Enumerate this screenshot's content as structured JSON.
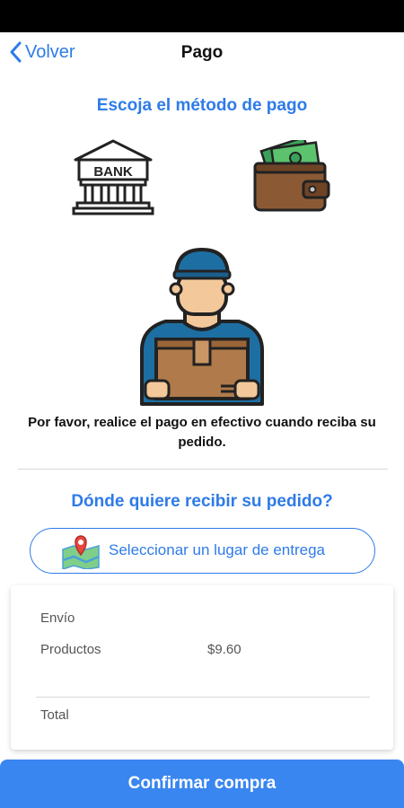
{
  "header": {
    "back_label": "Volver",
    "title": "Pago"
  },
  "payment": {
    "heading": "Escoja el método de pago",
    "bank_text": "BANK",
    "cash_message": "Por favor, realice el pago en efectivo cuando reciba su pedido."
  },
  "delivery": {
    "heading": "Dónde quiere recibir su pedido?",
    "select_label": "Seleccionar un lugar de entrega"
  },
  "summary": {
    "shipping_label": "Envío",
    "shipping_value": "",
    "products_label": "Productos",
    "products_value": "$9.60",
    "total_label": "Total",
    "total_value": ""
  },
  "confirm_label": "Confirmar compra",
  "colors": {
    "accent": "#2e7be8",
    "confirm_bg": "#3a86f0"
  }
}
